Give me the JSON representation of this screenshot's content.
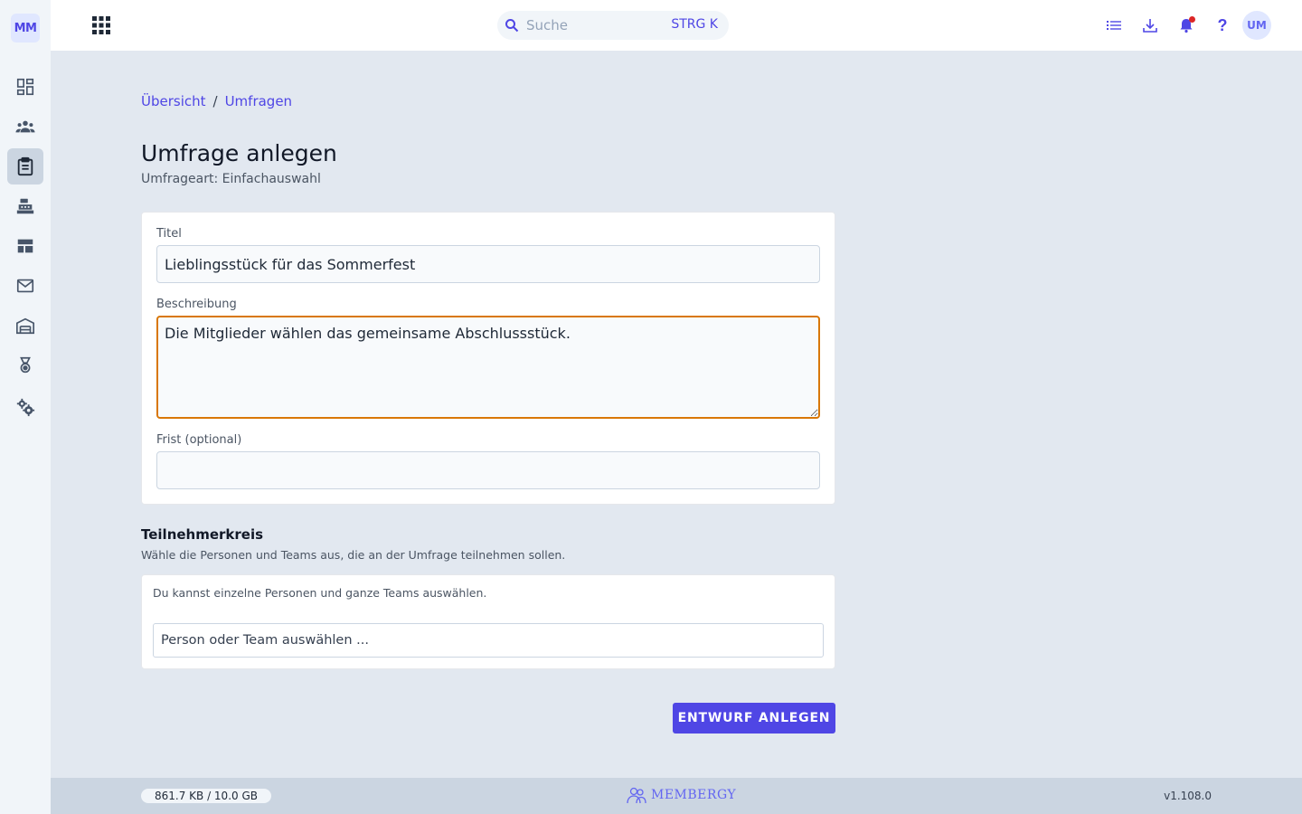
{
  "sidebar": {
    "logo": "MM",
    "items": [
      {
        "name": "dashboard",
        "active": false
      },
      {
        "name": "members",
        "active": false
      },
      {
        "name": "surveys",
        "active": true
      },
      {
        "name": "cashbox",
        "active": false
      },
      {
        "name": "layout",
        "active": false
      },
      {
        "name": "mail",
        "active": false
      },
      {
        "name": "inventory",
        "active": false
      },
      {
        "name": "awards",
        "active": false
      },
      {
        "name": "settings",
        "active": false
      }
    ]
  },
  "header": {
    "search_placeholder": "Suche",
    "search_shortcut": "STRG K",
    "avatar_initials": "UM"
  },
  "breadcrumb": {
    "items": [
      "Übersicht",
      "Umfragen"
    ],
    "separator": "/"
  },
  "page": {
    "title": "Umfrage anlegen",
    "subtitle": "Umfrageart: Einfachauswahl"
  },
  "form": {
    "title_label": "Titel",
    "title_value": "Lieblingsstück für das Sommerfest",
    "description_label": "Beschreibung",
    "description_value": "Die Mitglieder wählen das gemeinsame Abschlussstück.",
    "deadline_label": "Frist (optional)",
    "deadline_value": ""
  },
  "participants": {
    "title": "Teilnehmerkreis",
    "description": "Wähle die Personen und Teams aus, die an der Umfrage teilnehmen sollen.",
    "hint": "Du kannst einzelne Personen und ganze Teams auswählen.",
    "select_placeholder": "Person oder Team auswählen ..."
  },
  "actions": {
    "submit_label": "ENTWURF ANLEGEN"
  },
  "footer": {
    "storage": "861.7 KB / 10.0 GB",
    "brand": "MEMBERGY",
    "version": "v1.108.0"
  },
  "colors": {
    "accent": "#4f46e5",
    "focus": "#d97706",
    "notification": "#dc2626"
  }
}
